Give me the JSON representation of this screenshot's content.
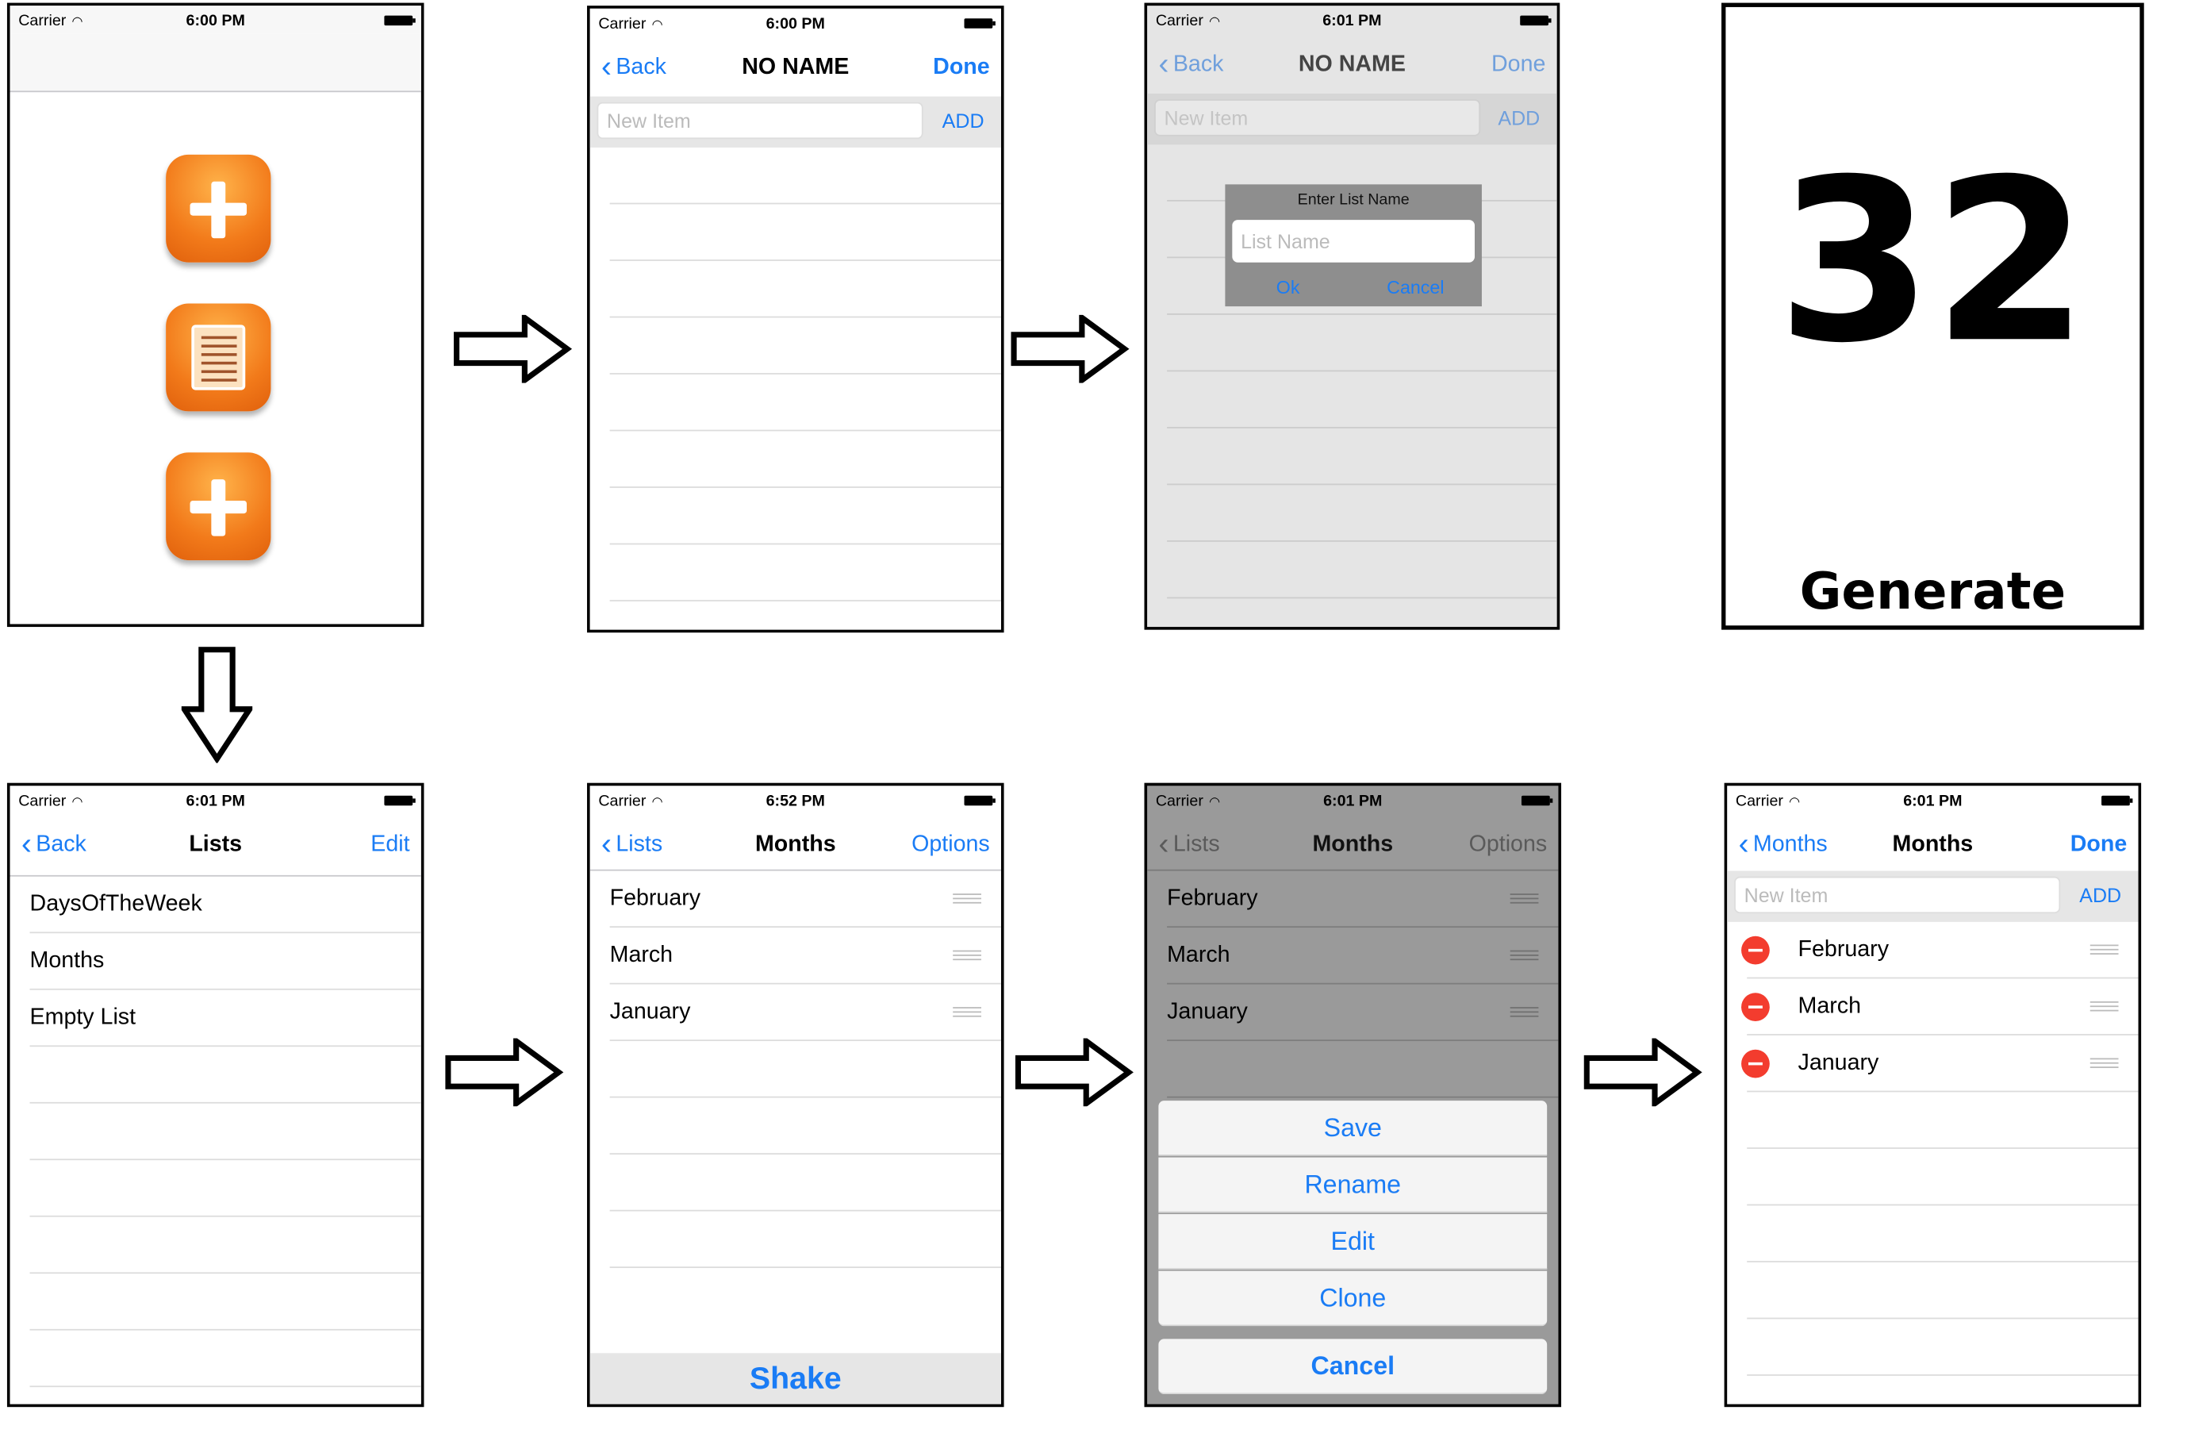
{
  "status": {
    "carrier": "Carrier",
    "times": [
      "6:00 PM",
      "6:00 PM",
      "6:01 PM",
      "6:01 PM",
      "6:52 PM",
      "6:01 PM",
      "6:01 PM"
    ]
  },
  "screen2": {
    "back": "Back",
    "title": "NO NAME",
    "done": "Done",
    "new_item_placeholder": "New Item",
    "add": "ADD"
  },
  "screen3": {
    "back": "Back",
    "title": "NO NAME",
    "done": "Done",
    "new_item_placeholder": "New Item",
    "add": "ADD",
    "alert_title": "Enter List Name",
    "alert_placeholder": "List Name",
    "ok": "Ok",
    "cancel": "Cancel"
  },
  "card": {
    "number": "32",
    "label": "Generate"
  },
  "lists_screen": {
    "back": "Back",
    "title": "Lists",
    "edit": "Edit",
    "items": [
      "DaysOfTheWeek",
      "Months",
      "Empty List"
    ]
  },
  "months_screen": {
    "back": "Lists",
    "title": "Months",
    "options": "Options",
    "items": [
      "February",
      "March",
      "January"
    ],
    "shake": "Shake"
  },
  "options_screen": {
    "back": "Lists",
    "title": "Months",
    "options": "Options",
    "items": [
      "February",
      "March",
      "January"
    ],
    "actions": [
      "Save",
      "Rename",
      "Edit",
      "Clone"
    ],
    "cancel": "Cancel"
  },
  "edit_screen": {
    "back": "Months",
    "title": "Months",
    "done": "Done",
    "new_item_placeholder": "New Item",
    "add": "ADD",
    "items": [
      "February",
      "March",
      "January"
    ]
  },
  "colors": {
    "ios_blue": "#1a7cf5",
    "orange_icon": "#f27a1a",
    "delete_red": "#f33c2e"
  }
}
